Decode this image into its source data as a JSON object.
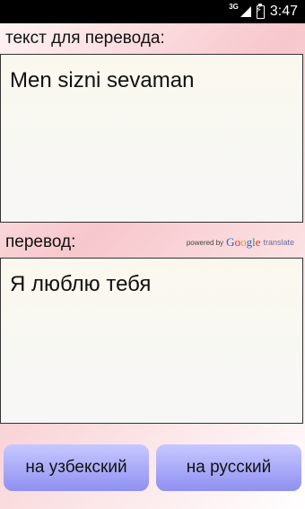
{
  "status_bar": {
    "network": "3G",
    "time": "3:47"
  },
  "source": {
    "label": "текст для перевода:",
    "text": "Men sizni sevaman"
  },
  "target": {
    "label": "перевод:",
    "text": "Я люблю тебя"
  },
  "attribution": {
    "powered_by": "powered by",
    "google": [
      "G",
      "o",
      "o",
      "g",
      "l",
      "e"
    ],
    "translate": "translate"
  },
  "buttons": {
    "to_uzbek": "на узбекский",
    "to_russian": "на русский"
  }
}
